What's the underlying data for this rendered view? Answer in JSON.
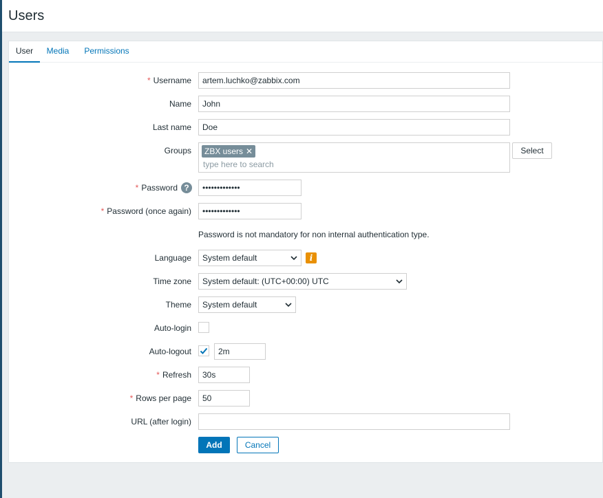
{
  "header": {
    "title": "Users"
  },
  "tabs": [
    {
      "label": "User",
      "active": true
    },
    {
      "label": "Media",
      "active": false
    },
    {
      "label": "Permissions",
      "active": false
    }
  ],
  "form": {
    "username": {
      "label": "Username",
      "required": true,
      "value": "artem.luchko@zabbix.com"
    },
    "name": {
      "label": "Name",
      "value": "John"
    },
    "last_name": {
      "label": "Last name",
      "value": "Doe"
    },
    "groups": {
      "label": "Groups",
      "chips": [
        "ZBX users"
      ],
      "placeholder": "type here to search",
      "select_button": "Select"
    },
    "password": {
      "label": "Password",
      "required": true,
      "value": "•••••••••••••"
    },
    "password_again": {
      "label": "Password (once again)",
      "required": true,
      "value": "•••••••••••••"
    },
    "password_note": "Password is not mandatory for non internal authentication type.",
    "language": {
      "label": "Language",
      "value": "System default",
      "info_icon": "i"
    },
    "time_zone": {
      "label": "Time zone",
      "value": "System default: (UTC+00:00) UTC"
    },
    "theme": {
      "label": "Theme",
      "value": "System default"
    },
    "auto_login": {
      "label": "Auto-login",
      "checked": false
    },
    "auto_logout": {
      "label": "Auto-logout",
      "checked": true,
      "value": "2m"
    },
    "refresh": {
      "label": "Refresh",
      "required": true,
      "value": "30s"
    },
    "rows_per_page": {
      "label": "Rows per page",
      "required": true,
      "value": "50"
    },
    "url_after_login": {
      "label": "URL (after login)",
      "value": ""
    },
    "buttons": {
      "add": "Add",
      "cancel": "Cancel"
    }
  },
  "icons": {
    "help": "question-mark-icon",
    "info": "info-icon",
    "chevron": "chevron-down-icon",
    "check": "checkmark-icon",
    "remove": "close-icon"
  },
  "colors": {
    "accent": "#0275b8",
    "required": "#e45959",
    "warning": "#e99003",
    "chip": "#768d99"
  }
}
